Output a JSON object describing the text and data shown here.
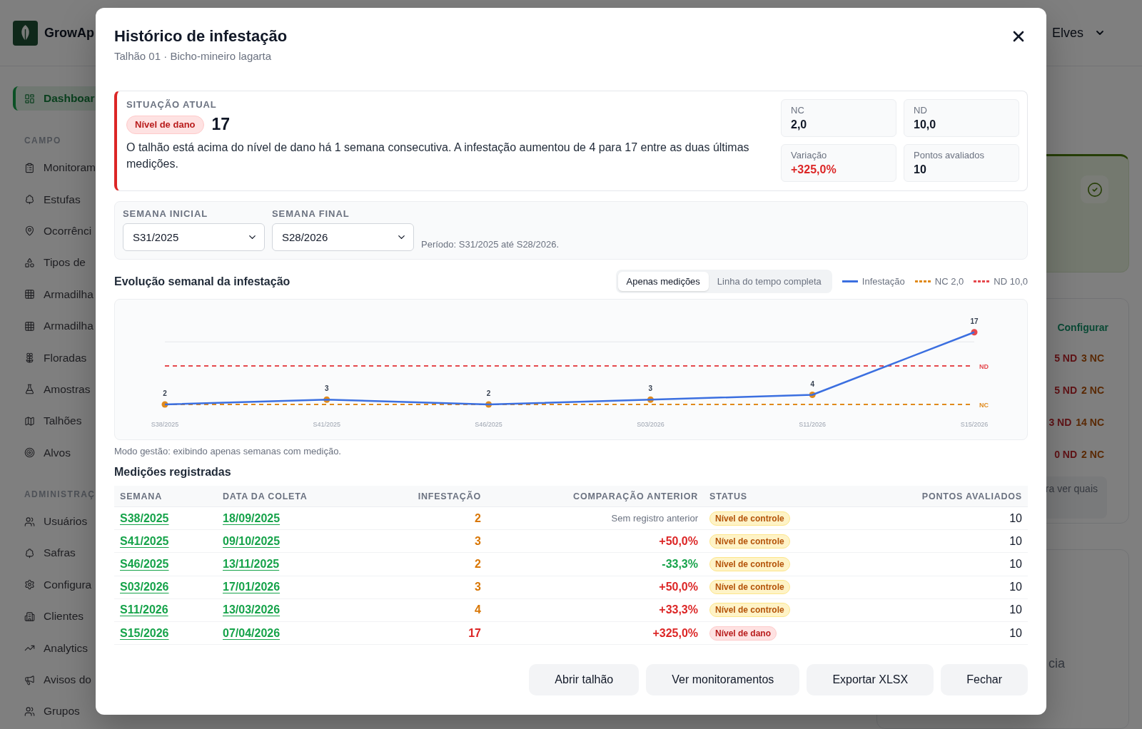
{
  "app": {
    "brand": "GrowAp",
    "user": "Elves",
    "sidebar": {
      "top_items": [
        {
          "label": "Dashboar",
          "selected": true
        }
      ],
      "sections": [
        {
          "heading": "CAMPO",
          "items": [
            {
              "label": "Monitoram",
              "selected": false
            },
            {
              "label": "Estufas",
              "selected": false
            },
            {
              "label": "Ocorrênci",
              "selected": false
            },
            {
              "label": "Tipos de",
              "selected": false
            },
            {
              "label": "Armadilha",
              "selected": false
            },
            {
              "label": "Armadilha",
              "selected": false
            },
            {
              "label": "Floradas",
              "selected": false
            },
            {
              "label": "Amostras",
              "selected": false
            },
            {
              "label": "Talhões",
              "selected": false
            },
            {
              "label": "Alvos",
              "selected": false
            }
          ]
        },
        {
          "heading": "ADMINISTRAÇ",
          "items": [
            {
              "label": "Usuários",
              "selected": false
            },
            {
              "label": "Safras",
              "selected": false
            },
            {
              "label": "Configura",
              "selected": false
            },
            {
              "label": "Clientes",
              "selected": false
            },
            {
              "label": "Analytics",
              "selected": false
            },
            {
              "label": "Avisos do",
              "selected": false
            },
            {
              "label": "Grupos",
              "selected": false
            }
          ]
        }
      ]
    },
    "side_panels": {
      "limits_card": {
        "link": "Configurar",
        "rows": [
          {
            "nd": "5 ND",
            "nc": "3 NC"
          },
          {
            "nd": "5 ND",
            "nc": "2 NC"
          },
          {
            "nd": "3 ND",
            "nc": "14 NC"
          },
          {
            "nd": "0 ND",
            "nc": "2 NC"
          }
        ],
        "note": "ra ver quais"
      },
      "lower_card": {
        "text": "cia"
      }
    }
  },
  "modal": {
    "title": "Histórico de infestação",
    "subtitle": "Talhão 01 · Bicho-mineiro lagarta",
    "current_status": {
      "heading": "SITUAÇÃO ATUAL",
      "badge": {
        "label": "Nível de dano",
        "kind": "damage"
      },
      "value": "17",
      "description": "O talhão está acima do nível de dano há 1 semana consecutiva. A infestação aumentou de 4 para 17 entre as duas últimas medições.",
      "stats": [
        {
          "label": "NC",
          "value": "2,0",
          "kind": "plain"
        },
        {
          "label": "ND",
          "value": "10,0",
          "kind": "plain"
        },
        {
          "label": "Variação",
          "value": "+325,0%",
          "kind": "increase"
        },
        {
          "label": "Pontos avaliados",
          "value": "10",
          "kind": "plain"
        }
      ]
    },
    "filters": [
      {
        "label": "SEMANA INICIAL",
        "value": "S31/2025"
      },
      {
        "label": "SEMANA FINAL",
        "value": "S28/2026"
      }
    ],
    "period": "Período: S31/2025 até S28/2026.",
    "chart_section": {
      "title": "Evolução semanal da infestação",
      "view_toggle": [
        {
          "label": "Apenas medições",
          "selected": true
        },
        {
          "label": "Linha do tempo completa",
          "selected": false
        }
      ],
      "legend": [
        {
          "label": "NC 2,0",
          "kind": "dashed",
          "color": "#e08a1c"
        },
        {
          "label": "ND 10,0",
          "kind": "dashed",
          "color": "#e5484d"
        }
      ],
      "chart_data": {
        "type": "line",
        "categories": [
          "S38/2025",
          "S41/2025",
          "S46/2025",
          "S03/2026",
          "S11/2026",
          "S15/2026"
        ],
        "series": [
          {
            "name": "Infestação",
            "color": "#3b6fe0",
            "marker": "circle",
            "values": [
              2,
              3,
              2,
              3,
              4,
              17
            ]
          }
        ],
        "data_labels": true,
        "ref_lines": [
          {
            "axis": "y",
            "value": 15,
            "color": "#e5e7eb"
          },
          {
            "axis": "y",
            "value": 10,
            "label": "ND",
            "color": "#e5484d"
          },
          {
            "axis": "y",
            "value": 2,
            "label": "NC",
            "color": "#e08a1c"
          }
        ]
      },
      "note": "Modo gestão: exibindo apenas semanas com medição."
    },
    "table": {
      "title": "Medições registradas",
      "columns": [
        "SEMANA",
        "DATA DA COLETA",
        "INFESTAÇÃO",
        "COMPARAÇÃO ANTERIOR",
        "STATUS",
        "PONTOS AVALIADOS"
      ],
      "rows": [
        {
          "week": "S38/2025",
          "date": "18/09/2025",
          "infestation": "2",
          "comparison": {
            "text": "Sem registro anterior",
            "kind": "none"
          },
          "status": {
            "label": "Nível de controle",
            "kind": "control"
          },
          "points": "10"
        },
        {
          "week": "S41/2025",
          "date": "09/10/2025",
          "infestation": "3",
          "comparison": {
            "text": "+50,0%",
            "kind": "increase"
          },
          "status": {
            "label": "Nível de controle",
            "kind": "control"
          },
          "points": "10"
        },
        {
          "week": "S46/2025",
          "date": "13/11/2025",
          "infestation": "2",
          "comparison": {
            "text": "-33,3%",
            "kind": "decrease"
          },
          "status": {
            "label": "Nível de controle",
            "kind": "control"
          },
          "points": "10"
        },
        {
          "week": "S03/2026",
          "date": "17/01/2026",
          "infestation": "3",
          "comparison": {
            "text": "+50,0%",
            "kind": "increase"
          },
          "status": {
            "label": "Nível de controle",
            "kind": "control"
          },
          "points": "10"
        },
        {
          "week": "S11/2026",
          "date": "13/03/2026",
          "infestation": "4",
          "comparison": {
            "text": "+33,3%",
            "kind": "increase"
          },
          "status": {
            "label": "Nível de controle",
            "kind": "control"
          },
          "points": "10"
        },
        {
          "week": "S15/2026",
          "date": "07/04/2026",
          "infestation": "17",
          "comparison": {
            "text": "+325,0%",
            "kind": "increase"
          },
          "status": {
            "label": "Nível de dano",
            "kind": "damage"
          },
          "points": "10"
        }
      ]
    },
    "buttons": [
      "Abrir talhão",
      "Ver monitoramentos",
      "Exportar XLSX",
      "Fechar"
    ]
  }
}
